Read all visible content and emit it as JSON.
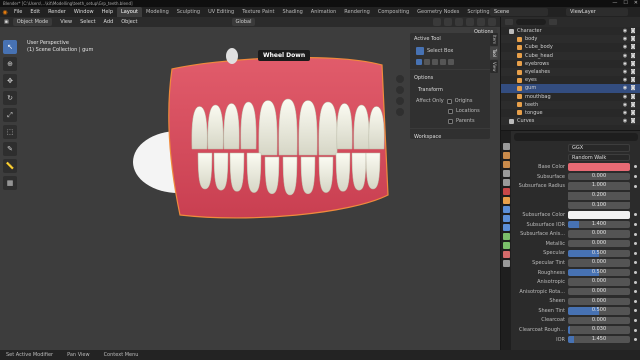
{
  "titlebar": {
    "text": "Blender* [C:\\Users\\...\\kit\\Modelling\\teeth_setup\\Grp_teeth.blend]",
    "controls": [
      "—",
      "☐",
      "✕"
    ]
  },
  "menubar": {
    "menus": [
      "File",
      "Edit",
      "Render",
      "Window",
      "Help"
    ],
    "tabs": [
      "Layout",
      "Modeling",
      "Sculpting",
      "UV Editing",
      "Texture Paint",
      "Shading",
      "Animation",
      "Rendering",
      "Compositing",
      "Geometry Nodes",
      "Scripting"
    ],
    "active_tab": "Layout",
    "scene": "Scene",
    "view_layer": "ViewLayer"
  },
  "viewport_header": {
    "mode": "Object Mode",
    "menus": [
      "View",
      "Select",
      "Add",
      "Object"
    ],
    "orientation": "Global"
  },
  "viewport": {
    "view_name": "User Perspective",
    "collection_info": "(1) Scene Collection | gum",
    "tooltip": "Wheel Down",
    "options_label": "Options"
  },
  "npanel": {
    "active_tool_label": "Active Tool",
    "tool_name": "Select Box",
    "options_label": "Options",
    "transform_label": "Transform",
    "affect_only_label": "Affect Only",
    "affect_items": [
      "Origins",
      "Locations",
      "Parents"
    ],
    "workspace_label": "Workspace",
    "vtabs": [
      "Item",
      "Tool",
      "View"
    ],
    "active_vtab": "Tool"
  },
  "outliner": {
    "items": [
      {
        "name": "Character",
        "icon_color": "#bbbbbb",
        "indent": 0,
        "selected": false
      },
      {
        "name": "body",
        "icon_color": "#e8a04a",
        "indent": 1,
        "selected": false
      },
      {
        "name": "Cube_body",
        "icon_color": "#e8a04a",
        "indent": 1,
        "selected": false
      },
      {
        "name": "Cube_head",
        "icon_color": "#e8a04a",
        "indent": 1,
        "selected": false
      },
      {
        "name": "eyebrows",
        "icon_color": "#e8a04a",
        "indent": 1,
        "selected": false
      },
      {
        "name": "eyelashes",
        "icon_color": "#e8a04a",
        "indent": 1,
        "selected": false
      },
      {
        "name": "eyes",
        "icon_color": "#e8a04a",
        "indent": 1,
        "selected": false
      },
      {
        "name": "gum",
        "icon_color": "#e8a04a",
        "indent": 1,
        "selected": true
      },
      {
        "name": "mouthbag",
        "icon_color": "#e8a04a",
        "indent": 1,
        "selected": false
      },
      {
        "name": "teeth",
        "icon_color": "#e8a04a",
        "indent": 1,
        "selected": false
      },
      {
        "name": "tongue",
        "icon_color": "#e8a04a",
        "indent": 1,
        "selected": false
      },
      {
        "name": "Curves",
        "icon_color": "#bbbbbb",
        "indent": 0,
        "selected": false
      }
    ]
  },
  "properties": {
    "distribution": "GGX",
    "subsurface_method": "Random Walk",
    "rows": [
      {
        "label": "Base Color",
        "type": "color",
        "color": "#e86a74"
      },
      {
        "label": "Subsurface",
        "type": "num",
        "value": "0.000",
        "fill": 0
      },
      {
        "label": "Subsurface Radius",
        "type": "num3a",
        "value": "1.000"
      },
      {
        "label": "",
        "type": "num3b",
        "value": "0.200"
      },
      {
        "label": "",
        "type": "num3c",
        "value": "0.100"
      },
      {
        "label": "Subsurface Color",
        "type": "color",
        "color": "#f2f2f2"
      },
      {
        "label": "Subsurface IOR",
        "type": "num",
        "value": "1.400",
        "fill": 0.18
      },
      {
        "label": "Subsurface Anis...",
        "type": "num",
        "value": "0.000",
        "fill": 0
      },
      {
        "label": "Metallic",
        "type": "num",
        "value": "0.000",
        "fill": 0
      },
      {
        "label": "Specular",
        "type": "num",
        "value": "0.500",
        "fill": 0.5
      },
      {
        "label": "Specular Tint",
        "type": "num",
        "value": "0.000",
        "fill": 0
      },
      {
        "label": "Roughness",
        "type": "num",
        "value": "0.500",
        "fill": 0.5
      },
      {
        "label": "Anisotropic",
        "type": "num",
        "value": "0.000",
        "fill": 0
      },
      {
        "label": "Anisotropic Rota...",
        "type": "num",
        "value": "0.000",
        "fill": 0
      },
      {
        "label": "Sheen",
        "type": "num",
        "value": "0.000",
        "fill": 0
      },
      {
        "label": "Sheen Tint",
        "type": "num",
        "value": "0.500",
        "fill": 0.5
      },
      {
        "label": "Clearcoat",
        "type": "num",
        "value": "0.000",
        "fill": 0
      },
      {
        "label": "Clearcoat Rough...",
        "type": "num",
        "value": "0.030",
        "fill": 0.03
      },
      {
        "label": "IOR",
        "type": "num",
        "value": "1.450",
        "fill": 0.1
      }
    ]
  },
  "statusbar": {
    "items": [
      "Set Active Modifier",
      "Pan View",
      "Context Menu"
    ]
  },
  "colors": {
    "accent": "#4772b3",
    "gum": "#d9495a",
    "teeth": "#ececdc",
    "orange": "#e87d0d"
  }
}
